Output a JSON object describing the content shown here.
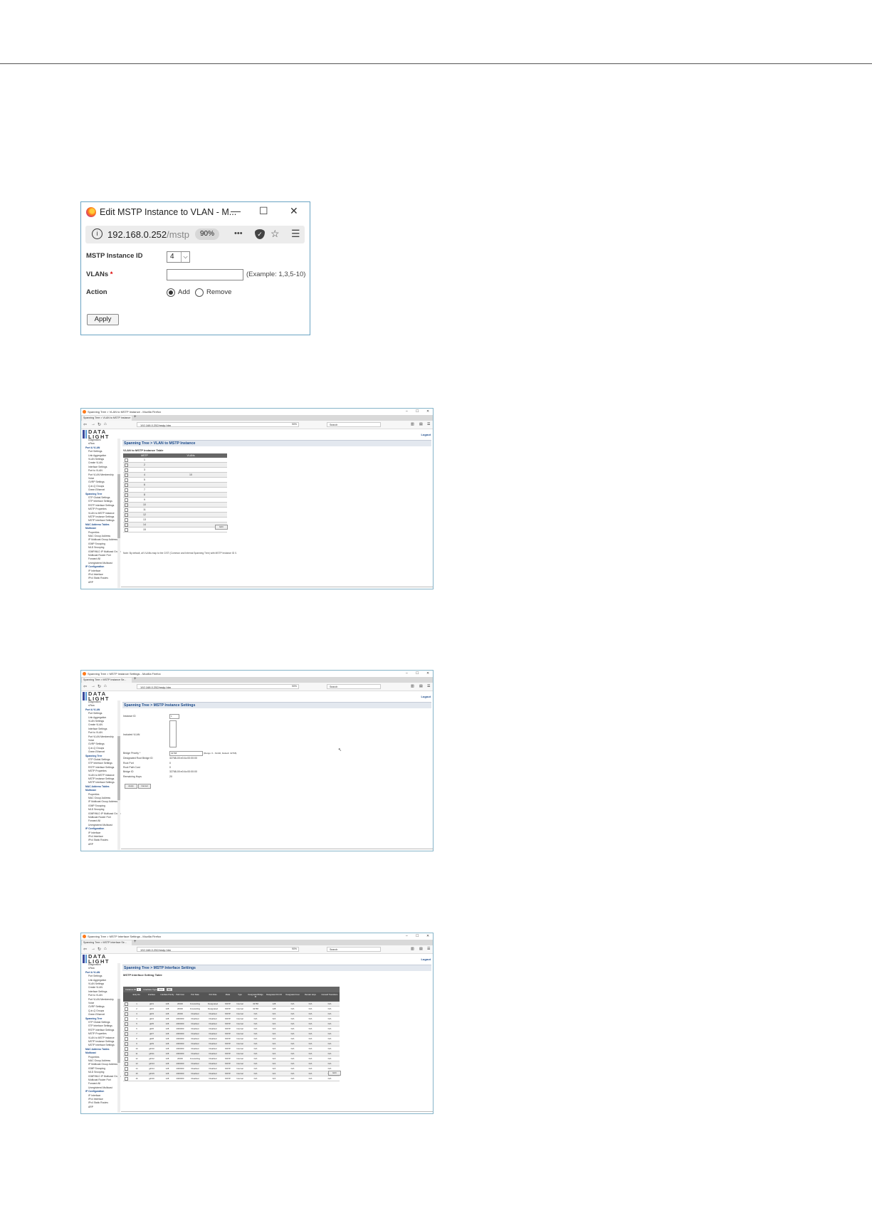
{
  "popup": {
    "title": "Edit MSTP Instance to VLAN - M...",
    "minimize": "—",
    "maximize": "☐",
    "close": "✕",
    "info_icon": "i",
    "url_host": "192.168.0.252",
    "url_path": "/mstp",
    "zoom": "90%",
    "more": "•••",
    "star": "☆",
    "menu": "☰",
    "instance_label": "MSTP Instance ID",
    "instance_value": "4",
    "vlans_label": "VLANs",
    "required_mark": "*",
    "vlans_value": "",
    "vlans_example": "(Example: 1,3,5-10)",
    "action_label": "Action",
    "action_add": "Add",
    "action_remove": "Remove",
    "action_selected": "Add",
    "apply": "Apply"
  },
  "browser_common": {
    "url": "192.168.0.252/mstp.htm",
    "zoom": "90%",
    "search_placeholder": "Search",
    "brand": "DATA LIGHT",
    "logout": "Logout",
    "new_tab": "+",
    "sidebar": [
      {
        "label": "Diagnostics",
        "group": false
      },
      {
        "label": "sFlow",
        "group": false
      },
      {
        "label": "Port & VLAN",
        "group": true
      },
      {
        "label": "Port Settings",
        "group": false
      },
      {
        "label": "Link Aggregation",
        "group": false
      },
      {
        "label": "VLAN Settings",
        "group": false
      },
      {
        "label": "Create VLAN",
        "group": false
      },
      {
        "label": "Interface Settings",
        "group": false
      },
      {
        "label": "Port to VLAN",
        "group": false
      },
      {
        "label": "Port VLAN Membership",
        "group": false
      },
      {
        "label": "Voice",
        "group": false
      },
      {
        "label": "GVRP Settings",
        "group": false
      },
      {
        "label": "Q-in-Q Groups",
        "group": false
      },
      {
        "label": "Green Ethernet",
        "group": false
      },
      {
        "label": "Spanning Tree",
        "group": true
      },
      {
        "label": "STP Global Settings",
        "group": false
      },
      {
        "label": "STP Interface Settings",
        "group": false
      },
      {
        "label": "RSTP Interface Settings",
        "group": false
      },
      {
        "label": "MSTP Properties",
        "group": false
      },
      {
        "label": "VLAN to MSTP Instance",
        "group": false
      },
      {
        "label": "MSTP Instance Settings",
        "group": false
      },
      {
        "label": "MSTP Interface Settings",
        "group": false
      },
      {
        "label": "MAC Address Tables",
        "group": true
      },
      {
        "label": "Multicast",
        "group": true
      },
      {
        "label": "Properties",
        "group": false
      },
      {
        "label": "MAC Group Address",
        "group": false
      },
      {
        "label": "IP Multicast Group Address",
        "group": false
      },
      {
        "label": "IGMP Snooping",
        "group": false
      },
      {
        "label": "MLD Snooping",
        "group": false
      },
      {
        "label": "IGMP/MLD IP Multicast Group",
        "group": false
      },
      {
        "label": "Multicast Router Port",
        "group": false
      },
      {
        "label": "Forward All",
        "group": false
      },
      {
        "label": "Unregistered Multicast",
        "group": false
      },
      {
        "label": "IP Configuration",
        "group": true
      },
      {
        "label": "IP Interface",
        "group": false
      },
      {
        "label": "IPv4 Interface",
        "group": false
      },
      {
        "label": "IPv4 Static Routes",
        "group": false
      },
      {
        "label": "ARP",
        "group": false
      }
    ]
  },
  "screen1": {
    "window_title": "Spanning Tree > VLAN to MSTP Instance - Mozilla Firefox",
    "tab": "Spanning Tree > VLAN to MSTP Instance",
    "heading": "Spanning Tree > VLAN to MSTP Instance",
    "table_title": "VLAN to MSTP Instance Table",
    "columns": [
      "MSTP Instance ID",
      "VLANs"
    ],
    "rows": [
      {
        "id": "1",
        "vlans": ""
      },
      {
        "id": "2",
        "vlans": ""
      },
      {
        "id": "3",
        "vlans": ""
      },
      {
        "id": "4",
        "vlans": "10"
      },
      {
        "id": "5",
        "vlans": ""
      },
      {
        "id": "6",
        "vlans": ""
      },
      {
        "id": "7",
        "vlans": ""
      },
      {
        "id": "8",
        "vlans": ""
      },
      {
        "id": "9",
        "vlans": ""
      },
      {
        "id": "10",
        "vlans": ""
      },
      {
        "id": "11",
        "vlans": ""
      },
      {
        "id": "12",
        "vlans": ""
      },
      {
        "id": "13",
        "vlans": ""
      },
      {
        "id": "14",
        "vlans": ""
      },
      {
        "id": "15",
        "vlans": ""
      }
    ],
    "edit": "Edit",
    "note": "Note: By default, all VLANs map to the CIST (Common and Internal Spanning Tree) with MSTP Instance ID 0."
  },
  "screen2": {
    "window_title": "Spanning Tree > MSTP Instance Settings - Mozilla Firefox",
    "tab": "Spanning Tree > MSTP Instance Se...",
    "heading": "Spanning Tree > MSTP Instance Settings",
    "fields": [
      {
        "label": "Instance ID",
        "value": "1"
      },
      {
        "label": "Included VLAN",
        "value": ""
      },
      {
        "label": "Bridge Priority *",
        "value": "32768",
        "hint": "(Range: 0 - 61440, Default: 32768)"
      },
      {
        "label": "Designated Root Bridge ID",
        "value": "32768-00:e0:4c:00:00:00"
      },
      {
        "label": "Root Port",
        "value": "0"
      },
      {
        "label": "Root Path Cost",
        "value": "0"
      },
      {
        "label": "Bridge ID",
        "value": "32768-00:e0:4c:00:00:00"
      },
      {
        "label": "Remaining Hops",
        "value": "20"
      }
    ],
    "apply": "Apply",
    "cancel": "Cancel"
  },
  "screen3": {
    "window_title": "Spanning Tree > MSTP Interface Settings - Mozilla Firefox",
    "tab": "Spanning Tree > MSTP Interface Se...",
    "heading": "Spanning Tree > MSTP Interface Settings",
    "table_title": "MSTP Interface Setting Table",
    "filter_instance": "Instance ID",
    "filter_instance_value": "1",
    "filter_type": "Interface Type",
    "filter_type_value": "Port",
    "filter_go": "Go",
    "columns": [
      "Entry No.",
      "Interface",
      "Interface Priority",
      "Path Cost",
      "Port State",
      "Port Role",
      "Mode",
      "Type",
      "Designated Bridge ID",
      "Designated Port ID",
      "Designated Cost",
      "Remain Hops",
      "Forward Transitions"
    ],
    "rows": [
      [
        "1",
        "gi0/1",
        "128",
        "20000",
        "Forwarding",
        "Designated",
        "MSTP",
        "Internal",
        "32768",
        "128",
        "N/A",
        "N/A",
        "N/A"
      ],
      [
        "2",
        "gi0/2",
        "128",
        "20000",
        "Forwarding",
        "Designated",
        "MSTP",
        "Internal",
        "32768",
        "128",
        "N/A",
        "N/A",
        "N/A"
      ],
      [
        "3",
        "gi0/3",
        "128",
        "20000",
        "Disabled",
        "Disabled",
        "MSTP",
        "Internal",
        "N/A",
        "N/A",
        "N/A",
        "N/A",
        "N/A"
      ],
      [
        "4",
        "gi0/4",
        "128",
        "2000000",
        "Disabled",
        "Disabled",
        "MSTP",
        "Internal",
        "N/A",
        "N/A",
        "N/A",
        "N/A",
        "N/A"
      ],
      [
        "5",
        "gi0/5",
        "128",
        "2000000",
        "Disabled",
        "Disabled",
        "MSTP",
        "Internal",
        "N/A",
        "N/A",
        "N/A",
        "N/A",
        "N/A"
      ],
      [
        "6",
        "gi0/6",
        "128",
        "2000000",
        "Disabled",
        "Disabled",
        "MSTP",
        "Internal",
        "N/A",
        "N/A",
        "N/A",
        "N/A",
        "N/A"
      ],
      [
        "7",
        "gi0/7",
        "128",
        "2000000",
        "Disabled",
        "Disabled",
        "MSTP",
        "Internal",
        "N/A",
        "N/A",
        "N/A",
        "N/A",
        "N/A"
      ],
      [
        "8",
        "gi0/8",
        "128",
        "2000000",
        "Disabled",
        "Disabled",
        "MSTP",
        "Internal",
        "N/A",
        "N/A",
        "N/A",
        "N/A",
        "N/A"
      ],
      [
        "9",
        "gi0/9",
        "128",
        "2000000",
        "Disabled",
        "Disabled",
        "MSTP",
        "Internal",
        "N/A",
        "N/A",
        "N/A",
        "N/A",
        "N/A"
      ],
      [
        "10",
        "gi0/10",
        "128",
        "2000000",
        "Disabled",
        "Disabled",
        "MSTP",
        "Internal",
        "N/A",
        "N/A",
        "N/A",
        "N/A",
        "N/A"
      ],
      [
        "11",
        "gi0/11",
        "128",
        "2000000",
        "Disabled",
        "Disabled",
        "MSTP",
        "Internal",
        "N/A",
        "N/A",
        "N/A",
        "N/A",
        "N/A"
      ],
      [
        "12",
        "gi0/12",
        "128",
        "20000",
        "Forwarding",
        "Disabled",
        "MSTP",
        "Internal",
        "N/A",
        "N/A",
        "N/A",
        "N/A",
        "N/A"
      ],
      [
        "13",
        "gi0/13",
        "128",
        "2000000",
        "Disabled",
        "Disabled",
        "MSTP",
        "Internal",
        "N/A",
        "N/A",
        "N/A",
        "N/A",
        "N/A"
      ],
      [
        "14",
        "gi0/14",
        "128",
        "2000000",
        "Disabled",
        "Disabled",
        "MSTP",
        "Internal",
        "N/A",
        "N/A",
        "N/A",
        "N/A",
        "N/A"
      ],
      [
        "15",
        "gi0/15",
        "128",
        "2000000",
        "Disabled",
        "Disabled",
        "MSTP",
        "Internal",
        "N/A",
        "N/A",
        "N/A",
        "N/A",
        "N/A"
      ],
      [
        "16",
        "gi0/16",
        "128",
        "2000000",
        "Disabled",
        "Disabled",
        "MSTP",
        "Internal",
        "N/A",
        "N/A",
        "N/A",
        "N/A",
        "N/A"
      ]
    ],
    "edit": "Edit"
  }
}
